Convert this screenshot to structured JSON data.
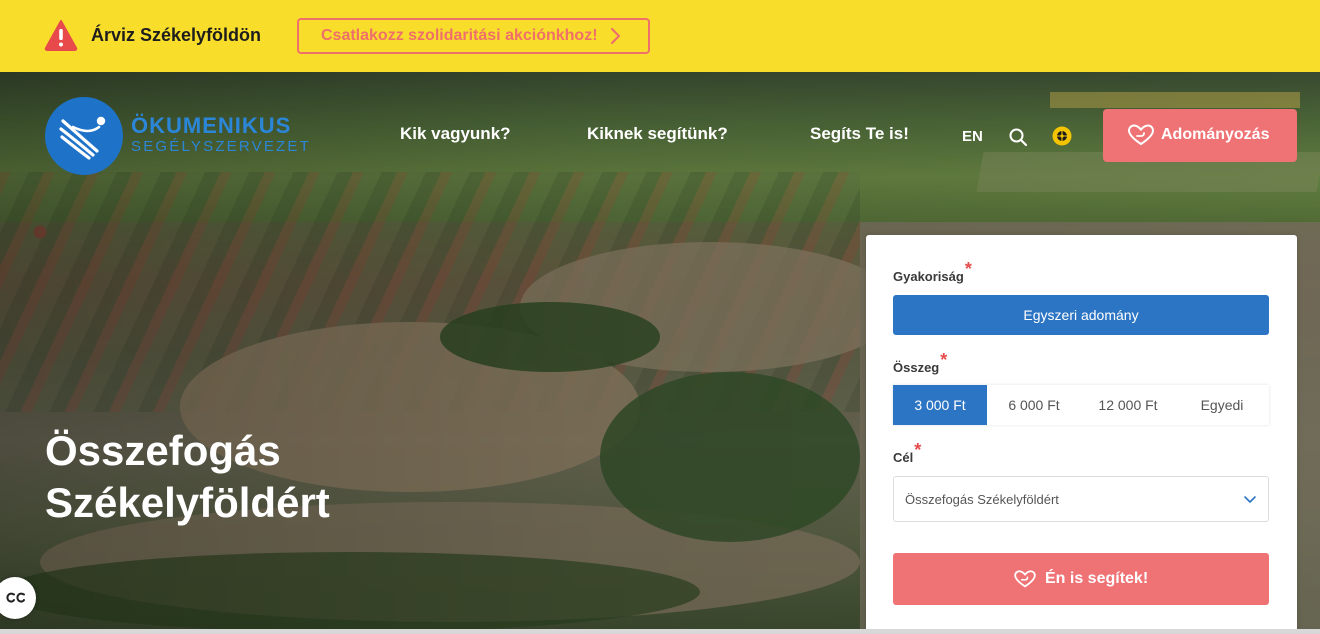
{
  "alert": {
    "title": "Árviz Székelyföldön",
    "cta": "Csatlakozz szolidaritási akciónkhoz!"
  },
  "logo": {
    "line1": "ÖKUMENIKUS",
    "line2": "SEGÉLYSZERVEZET"
  },
  "nav": {
    "items": [
      "Kik vagyunk?",
      "Kiknek segítünk?",
      "Segíts Te is!"
    ],
    "language": "EN",
    "donate": "Adományozás"
  },
  "hero": {
    "title_line1": "Összefogás",
    "title_line2": "Székelyföldért"
  },
  "form": {
    "frequency_label": "Gyakoriság",
    "frequency_value": "Egyszeri adomány",
    "amount_label": "Összeg",
    "amounts": [
      "3 000 Ft",
      "6 000 Ft",
      "12 000 Ft",
      "Egyedi"
    ],
    "selected_amount": "3 000 Ft",
    "goal_label": "Cél",
    "goal_value": "Összefogás Székelyföldért",
    "submit": "Én is segítek!",
    "required_mark": "*"
  },
  "colors": {
    "alert_bg": "#f8de2a",
    "accent_red": "#ef7375",
    "primary_blue": "#2c74c4"
  },
  "icons": {
    "alert": "warning-triangle-icon",
    "search": "search-icon",
    "accessibility": "accessibility-icon",
    "donate": "heart-hand-icon",
    "captions": "closed-captions-icon"
  }
}
